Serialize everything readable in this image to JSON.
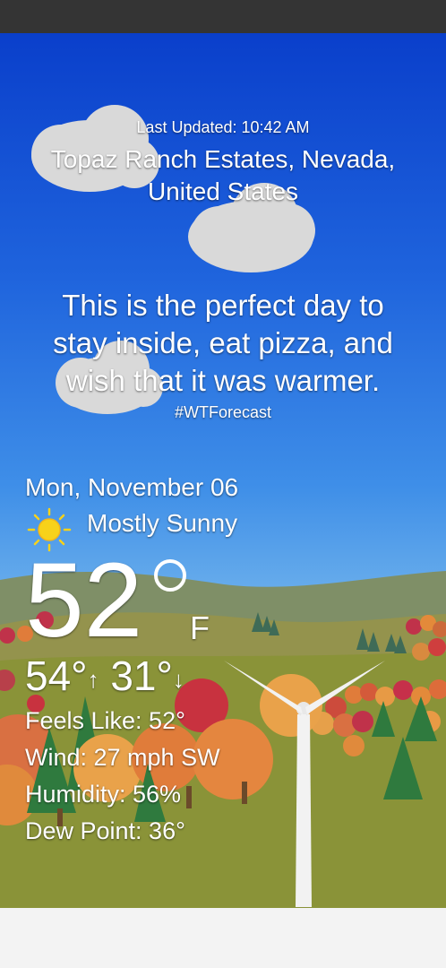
{
  "header": {
    "last_updated": "Last Updated: 10:42 AM",
    "location": "Topaz Ranch Estates, Nevada, United States"
  },
  "forecast": {
    "quote": "This is the perfect day to stay inside, eat pizza, and wish that it was warmer.",
    "hashtag": "#WTForecast"
  },
  "today": {
    "date": "Mon, November 06",
    "condition_icon": "sun-icon",
    "condition": "Mostly Sunny",
    "temperature": "52",
    "unit": "F",
    "high": "54°",
    "high_arrow": "↑",
    "low": "31°",
    "low_arrow": "↓",
    "feels_like": "Feels Like:  52°",
    "wind": "Wind:  27 mph SW",
    "humidity": "Humidity:  56%",
    "dew_point": "Dew Point:  36°"
  },
  "colors": {
    "sky_top": "#0a3fcb",
    "sky_bottom": "#8dc4ee",
    "hill_far": "#7f8f67",
    "field": "#8a9338",
    "status_bar": "#343434",
    "sun": "#f7d21a"
  }
}
